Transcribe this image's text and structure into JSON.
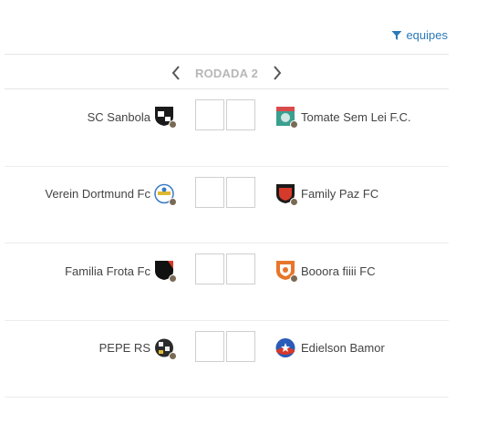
{
  "filter": {
    "label": "equipes",
    "icon": "filter-icon",
    "color": "#2a7ab8"
  },
  "round": {
    "label": "RODADA 2",
    "prev_icon": "chevron-left-icon",
    "next_icon": "chevron-right-icon"
  },
  "matches": [
    {
      "home": {
        "name": "SC Sanbola",
        "crest": {
          "colors": [
            "#1a1a1a",
            "#ffffff"
          ]
        }
      },
      "away": {
        "name": "Tomate Sem Lei F.C.",
        "crest": {
          "colors": [
            "#3a9f8f",
            "#d94b4b"
          ]
        }
      },
      "home_score": "",
      "away_score": ""
    },
    {
      "home": {
        "name": "Verein Dortmund Fc",
        "crest": {
          "colors": [
            "#ffffff",
            "#3b7bc4"
          ]
        }
      },
      "away": {
        "name": "Family Paz FC",
        "crest": {
          "colors": [
            "#1a1a1a",
            "#d63a2a"
          ]
        }
      },
      "home_score": "",
      "away_score": ""
    },
    {
      "home": {
        "name": "Familia Frota Fc",
        "crest": {
          "colors": [
            "#111111",
            "#d63a2a"
          ]
        }
      },
      "away": {
        "name": "Booora fiiii FC",
        "crest": {
          "colors": [
            "#e8762a",
            "#ffffff"
          ]
        }
      },
      "home_score": "",
      "away_score": ""
    },
    {
      "home": {
        "name": "PEPE RS",
        "crest": {
          "colors": [
            "#2b2b2b",
            "#f1f1f1"
          ]
        }
      },
      "away": {
        "name": "Edielson Bamor",
        "crest": {
          "colors": [
            "#2a5bb8",
            "#d63a2a"
          ]
        }
      },
      "home_score": "",
      "away_score": ""
    }
  ]
}
